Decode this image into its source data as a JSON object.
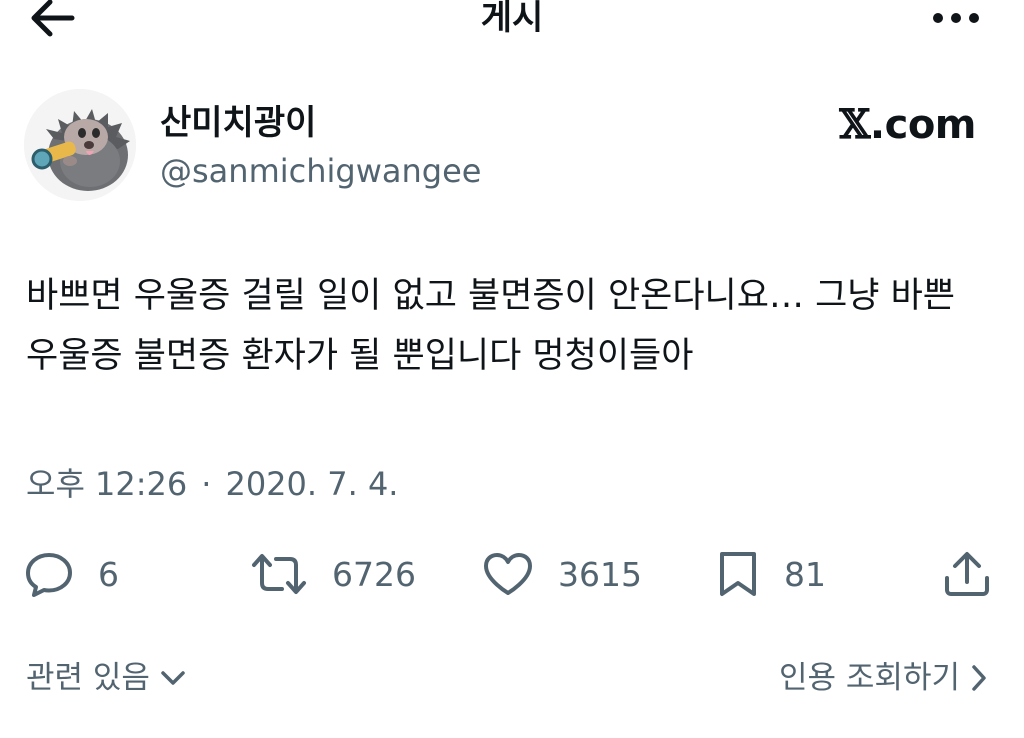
{
  "header": {
    "title": "게시",
    "back_icon": "arrow-left-icon",
    "more_icon": "more-horizontal-icon"
  },
  "author": {
    "name": "산미치광이",
    "handle": "@sanmichigwangee",
    "avatar_icon": "porcupine-with-binoculars-avatar"
  },
  "source": {
    "x_mark": "𝕏",
    "suffix": ".com"
  },
  "tweet": {
    "text": "바쁘면 우울증 걸릴 일이 없고 불면증이 안온다니요… 그냥 바쁜 우울증 불면증 환자가 될 뿐입니다 멍청이들아"
  },
  "meta": {
    "time": "오후 12:26",
    "separator": "·",
    "date": "2020. 7. 4."
  },
  "actions": {
    "reply_count": "6",
    "retweet_count": "6726",
    "like_count": "3615",
    "bookmark_count": "81",
    "icons": [
      "reply-icon",
      "retweet-icon",
      "like-icon",
      "bookmark-icon",
      "share-icon"
    ]
  },
  "footer": {
    "related_label": "관련 있음",
    "quotes_label": "인용 조회하기"
  },
  "colors": {
    "text": "#0f1419",
    "secondary": "#536471",
    "background": "#ffffff"
  }
}
